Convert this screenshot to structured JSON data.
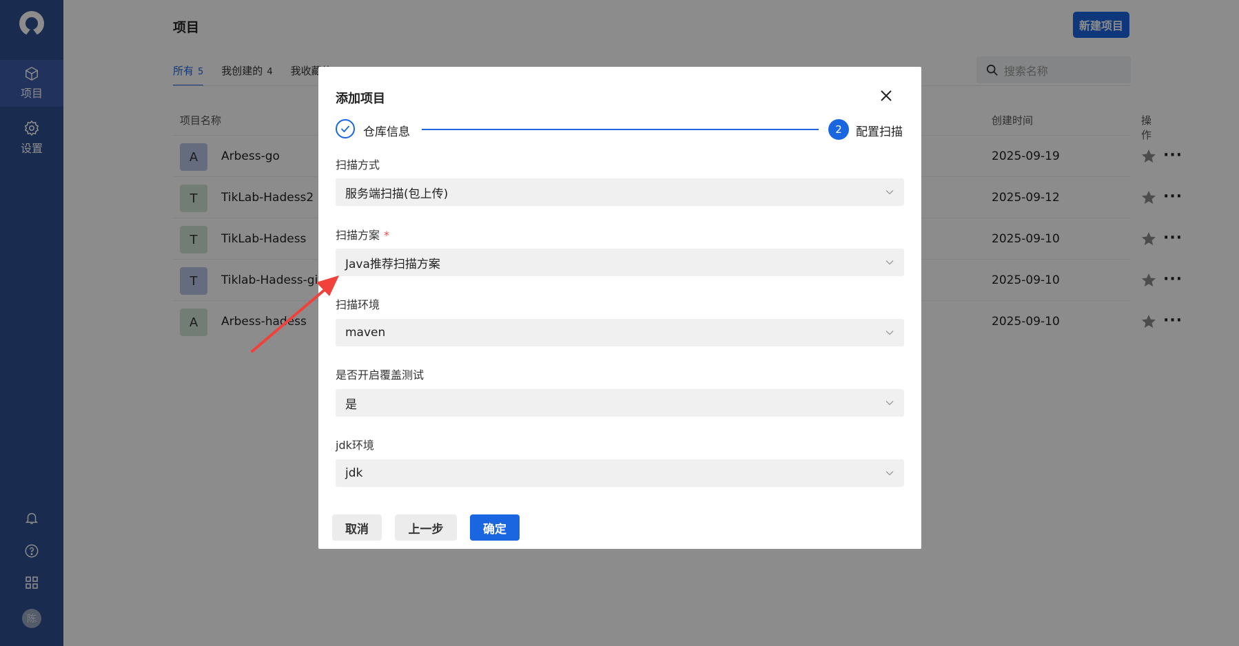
{
  "sidebar": {
    "items": [
      {
        "label": "项目",
        "icon": "cube-icon",
        "active": true
      },
      {
        "label": "设置",
        "icon": "gear-icon",
        "active": false
      }
    ],
    "bottom_icons": [
      "bell-icon",
      "help-icon",
      "apps-grid-icon"
    ],
    "avatar_text": "陈"
  },
  "header": {
    "title": "项目",
    "new_button": "新建项目"
  },
  "tabs": [
    {
      "label": "所有",
      "count": "5",
      "active": true
    },
    {
      "label": "我创建的",
      "count": "4",
      "active": false
    },
    {
      "label": "我收藏的",
      "count": "",
      "active": false
    }
  ],
  "search": {
    "placeholder": "搜索名称"
  },
  "table": {
    "columns": {
      "name": "项目名称",
      "created": "创建时间",
      "actions": "操作"
    },
    "rows": [
      {
        "initial": "A",
        "name": "Arbess-go",
        "date": "2025-09-19",
        "avatar_color": "#b8c5e6"
      },
      {
        "initial": "T",
        "name": "TikLab-Hadess2",
        "date": "2025-09-12",
        "avatar_color": "#cfe3d6"
      },
      {
        "initial": "T",
        "name": "TikLab-Hadess",
        "date": "2025-09-10",
        "avatar_color": "#cfe3d6"
      },
      {
        "initial": "T",
        "name": "Tiklab-Hadess-git",
        "date": "2025-09-10",
        "avatar_color": "#b8c5e6"
      },
      {
        "initial": "A",
        "name": "Arbess-hadess",
        "date": "2025-09-10",
        "avatar_color": "#cfe3d6"
      }
    ],
    "more_label": "···"
  },
  "modal": {
    "title": "添加项目",
    "steps": [
      {
        "label": "仓库信息",
        "state": "done"
      },
      {
        "label": "配置扫描",
        "number": "2",
        "state": "current"
      }
    ],
    "fields": {
      "scan_method": {
        "label": "扫描方式",
        "value": "服务端扫描(包上传)"
      },
      "scan_plan": {
        "label": "扫描方案",
        "required_mark": "*",
        "value": "Java推荐扫描方案"
      },
      "scan_env": {
        "label": "扫描环境",
        "value": "maven"
      },
      "coverage": {
        "label": "是否开启覆盖测试",
        "value": "是"
      },
      "jdk_env": {
        "label": "jdk环境",
        "value": "jdk"
      }
    },
    "buttons": {
      "cancel": "取消",
      "prev": "上一步",
      "confirm": "确定"
    }
  },
  "colors": {
    "sidebar": "#2f4f8f",
    "primary": "#1a66e0",
    "annotation_arrow": "#f0413a"
  }
}
